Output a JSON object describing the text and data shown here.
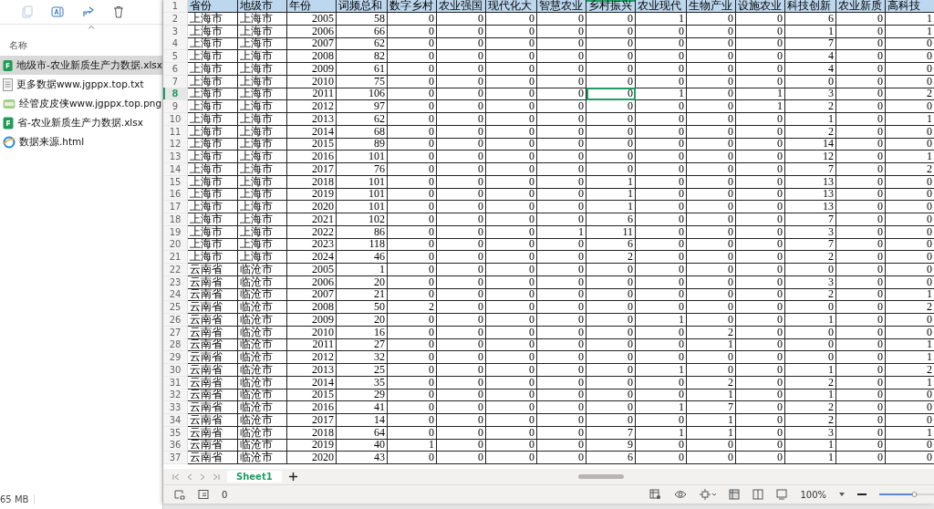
{
  "explorer": {
    "column_header": "名称",
    "files": [
      {
        "name": "地级市-农业新质生产力数据.xlsx",
        "kind": "sheet",
        "selected": true
      },
      {
        "name": "更多数据www.jgppx.top.txt",
        "kind": "text",
        "selected": false
      },
      {
        "name": "经管皮皮侠www.jgppx.top.png",
        "kind": "image",
        "selected": false
      },
      {
        "name": "省-农业新质生产力数据.xlsx",
        "kind": "sheet",
        "selected": false
      },
      {
        "name": "数据来源.html",
        "kind": "web",
        "selected": false
      }
    ],
    "status": "65 MB"
  },
  "sheet": {
    "header_row": "1",
    "columns": [
      {
        "label": "省份",
        "kind": "text",
        "selected": false
      },
      {
        "label": "地级市",
        "kind": "text",
        "selected": false
      },
      {
        "label": "年份",
        "kind": "number",
        "selected": false
      },
      {
        "label": "词频总和",
        "kind": "number",
        "selected": false
      },
      {
        "label": "数字乡村",
        "kind": "number",
        "selected": false
      },
      {
        "label": "农业强国",
        "kind": "number",
        "selected": false
      },
      {
        "label": "现代化大",
        "kind": "number",
        "selected": false
      },
      {
        "label": "智慧农业",
        "kind": "number",
        "selected": false
      },
      {
        "label": "乡村振兴",
        "kind": "number",
        "selected": true
      },
      {
        "label": "农业现代",
        "kind": "number",
        "selected": false
      },
      {
        "label": "生物产业",
        "kind": "number",
        "selected": false
      },
      {
        "label": "设施农业",
        "kind": "number",
        "selected": false
      },
      {
        "label": "科技创新",
        "kind": "number",
        "selected": false
      },
      {
        "label": "农业新质",
        "kind": "number",
        "selected": false
      },
      {
        "label": "高科技",
        "kind": "number",
        "selected": false
      }
    ],
    "rows": [
      {
        "n": "2",
        "selected": false,
        "cells": [
          "上海市",
          "上海市",
          "2005",
          "58",
          "0",
          "0",
          "0",
          "0",
          "0",
          "1",
          "0",
          "0",
          "6",
          "0",
          "1"
        ]
      },
      {
        "n": "3",
        "selected": false,
        "cells": [
          "上海市",
          "上海市",
          "2006",
          "66",
          "0",
          "0",
          "0",
          "0",
          "0",
          "0",
          "0",
          "0",
          "1",
          "0",
          "1"
        ]
      },
      {
        "n": "4",
        "selected": false,
        "cells": [
          "上海市",
          "上海市",
          "2007",
          "62",
          "0",
          "0",
          "0",
          "0",
          "0",
          "0",
          "0",
          "0",
          "7",
          "0",
          "0"
        ]
      },
      {
        "n": "5",
        "selected": false,
        "cells": [
          "上海市",
          "上海市",
          "2008",
          "82",
          "0",
          "0",
          "0",
          "0",
          "0",
          "0",
          "0",
          "0",
          "4",
          "0",
          "0"
        ]
      },
      {
        "n": "6",
        "selected": false,
        "cells": [
          "上海市",
          "上海市",
          "2009",
          "61",
          "0",
          "0",
          "0",
          "0",
          "0",
          "0",
          "0",
          "0",
          "4",
          "0",
          "0"
        ]
      },
      {
        "n": "7",
        "selected": false,
        "cells": [
          "上海市",
          "上海市",
          "2010",
          "75",
          "0",
          "0",
          "0",
          "0",
          "0",
          "0",
          "0",
          "0",
          "0",
          "0",
          "0"
        ]
      },
      {
        "n": "8",
        "selected": true,
        "cells": [
          "上海市",
          "上海市",
          "2011",
          "106",
          "0",
          "0",
          "0",
          "0",
          "0",
          "1",
          "0",
          "1",
          "3",
          "0",
          "2"
        ]
      },
      {
        "n": "9",
        "selected": false,
        "cells": [
          "上海市",
          "上海市",
          "2012",
          "97",
          "0",
          "0",
          "0",
          "0",
          "0",
          "0",
          "0",
          "1",
          "2",
          "0",
          "0"
        ]
      },
      {
        "n": "10",
        "selected": false,
        "cells": [
          "上海市",
          "上海市",
          "2013",
          "62",
          "0",
          "0",
          "0",
          "0",
          "0",
          "0",
          "0",
          "0",
          "1",
          "0",
          "1"
        ]
      },
      {
        "n": "11",
        "selected": false,
        "cells": [
          "上海市",
          "上海市",
          "2014",
          "68",
          "0",
          "0",
          "0",
          "0",
          "0",
          "0",
          "0",
          "0",
          "2",
          "0",
          "0"
        ]
      },
      {
        "n": "12",
        "selected": false,
        "cells": [
          "上海市",
          "上海市",
          "2015",
          "89",
          "0",
          "0",
          "0",
          "0",
          "0",
          "0",
          "0",
          "0",
          "14",
          "0",
          "0"
        ]
      },
      {
        "n": "13",
        "selected": false,
        "cells": [
          "上海市",
          "上海市",
          "2016",
          "101",
          "0",
          "0",
          "0",
          "0",
          "0",
          "0",
          "0",
          "0",
          "12",
          "0",
          "1"
        ]
      },
      {
        "n": "14",
        "selected": false,
        "cells": [
          "上海市",
          "上海市",
          "2017",
          "76",
          "0",
          "0",
          "0",
          "0",
          "0",
          "0",
          "0",
          "0",
          "7",
          "0",
          "2"
        ]
      },
      {
        "n": "15",
        "selected": false,
        "cells": [
          "上海市",
          "上海市",
          "2018",
          "101",
          "0",
          "0",
          "0",
          "0",
          "1",
          "0",
          "0",
          "0",
          "13",
          "0",
          "0"
        ]
      },
      {
        "n": "16",
        "selected": false,
        "cells": [
          "上海市",
          "上海市",
          "2019",
          "101",
          "0",
          "0",
          "0",
          "0",
          "1",
          "0",
          "0",
          "0",
          "13",
          "0",
          "0"
        ]
      },
      {
        "n": "17",
        "selected": false,
        "cells": [
          "上海市",
          "上海市",
          "2020",
          "101",
          "0",
          "0",
          "0",
          "0",
          "1",
          "0",
          "0",
          "0",
          "13",
          "0",
          "0"
        ]
      },
      {
        "n": "18",
        "selected": false,
        "cells": [
          "上海市",
          "上海市",
          "2021",
          "102",
          "0",
          "0",
          "0",
          "0",
          "6",
          "0",
          "0",
          "0",
          "7",
          "0",
          "0"
        ]
      },
      {
        "n": "19",
        "selected": false,
        "cells": [
          "上海市",
          "上海市",
          "2022",
          "86",
          "0",
          "0",
          "0",
          "1",
          "11",
          "0",
          "0",
          "0",
          "3",
          "0",
          "0"
        ]
      },
      {
        "n": "20",
        "selected": false,
        "cells": [
          "上海市",
          "上海市",
          "2023",
          "118",
          "0",
          "0",
          "0",
          "0",
          "6",
          "0",
          "0",
          "0",
          "7",
          "0",
          "0"
        ]
      },
      {
        "n": "21",
        "selected": false,
        "cells": [
          "上海市",
          "上海市",
          "2024",
          "46",
          "0",
          "0",
          "0",
          "0",
          "2",
          "0",
          "0",
          "0",
          "2",
          "0",
          "0"
        ]
      },
      {
        "n": "22",
        "selected": false,
        "cells": [
          "云南省",
          "临沧市",
          "2005",
          "1",
          "0",
          "0",
          "0",
          "0",
          "0",
          "0",
          "0",
          "0",
          "0",
          "0",
          "0"
        ]
      },
      {
        "n": "23",
        "selected": false,
        "cells": [
          "云南省",
          "临沧市",
          "2006",
          "20",
          "0",
          "0",
          "0",
          "0",
          "0",
          "0",
          "0",
          "0",
          "3",
          "0",
          "0"
        ]
      },
      {
        "n": "24",
        "selected": false,
        "cells": [
          "云南省",
          "临沧市",
          "2007",
          "21",
          "0",
          "0",
          "0",
          "0",
          "0",
          "0",
          "0",
          "0",
          "2",
          "0",
          "1"
        ]
      },
      {
        "n": "25",
        "selected": false,
        "cells": [
          "云南省",
          "临沧市",
          "2008",
          "50",
          "2",
          "0",
          "0",
          "0",
          "0",
          "0",
          "0",
          "0",
          "0",
          "0",
          "2"
        ]
      },
      {
        "n": "26",
        "selected": false,
        "cells": [
          "云南省",
          "临沧市",
          "2009",
          "20",
          "0",
          "0",
          "0",
          "0",
          "0",
          "1",
          "0",
          "0",
          "1",
          "0",
          "0"
        ]
      },
      {
        "n": "27",
        "selected": false,
        "cells": [
          "云南省",
          "临沧市",
          "2010",
          "16",
          "0",
          "0",
          "0",
          "0",
          "0",
          "0",
          "2",
          "0",
          "0",
          "0",
          "0"
        ]
      },
      {
        "n": "28",
        "selected": false,
        "cells": [
          "云南省",
          "临沧市",
          "2011",
          "27",
          "0",
          "0",
          "0",
          "0",
          "0",
          "0",
          "1",
          "0",
          "0",
          "0",
          "1"
        ]
      },
      {
        "n": "29",
        "selected": false,
        "cells": [
          "云南省",
          "临沧市",
          "2012",
          "32",
          "0",
          "0",
          "0",
          "0",
          "0",
          "0",
          "0",
          "0",
          "0",
          "0",
          "1"
        ]
      },
      {
        "n": "30",
        "selected": false,
        "cells": [
          "云南省",
          "临沧市",
          "2013",
          "25",
          "0",
          "0",
          "0",
          "0",
          "0",
          "1",
          "0",
          "0",
          "1",
          "0",
          "2"
        ]
      },
      {
        "n": "31",
        "selected": false,
        "cells": [
          "云南省",
          "临沧市",
          "2014",
          "35",
          "0",
          "0",
          "0",
          "0",
          "0",
          "0",
          "2",
          "0",
          "2",
          "0",
          "1"
        ]
      },
      {
        "n": "32",
        "selected": false,
        "cells": [
          "云南省",
          "临沧市",
          "2015",
          "29",
          "0",
          "0",
          "0",
          "0",
          "0",
          "0",
          "1",
          "0",
          "1",
          "0",
          "0"
        ]
      },
      {
        "n": "33",
        "selected": false,
        "cells": [
          "云南省",
          "临沧市",
          "2016",
          "41",
          "0",
          "0",
          "0",
          "0",
          "0",
          "1",
          "7",
          "0",
          "2",
          "0",
          "0"
        ]
      },
      {
        "n": "34",
        "selected": false,
        "cells": [
          "云南省",
          "临沧市",
          "2017",
          "14",
          "0",
          "0",
          "0",
          "0",
          "0",
          "0",
          "1",
          "0",
          "2",
          "0",
          "0"
        ]
      },
      {
        "n": "35",
        "selected": false,
        "cells": [
          "云南省",
          "临沧市",
          "2018",
          "64",
          "0",
          "0",
          "0",
          "0",
          "7",
          "1",
          "1",
          "0",
          "3",
          "0",
          "1"
        ]
      },
      {
        "n": "36",
        "selected": false,
        "cells": [
          "云南省",
          "临沧市",
          "2019",
          "40",
          "1",
          "0",
          "0",
          "0",
          "9",
          "0",
          "0",
          "0",
          "1",
          "0",
          "0"
        ]
      },
      {
        "n": "37",
        "selected": false,
        "cells": [
          "云南省",
          "临沧市",
          "2020",
          "43",
          "0",
          "0",
          "0",
          "0",
          "6",
          "0",
          "0",
          "0",
          "1",
          "0",
          "0"
        ]
      }
    ],
    "tabs": [
      {
        "label": "Sheet1",
        "selected": true
      }
    ],
    "status_count": "0",
    "zoom": "100%",
    "zoom_slider": {
      "level": 0.67
    }
  }
}
